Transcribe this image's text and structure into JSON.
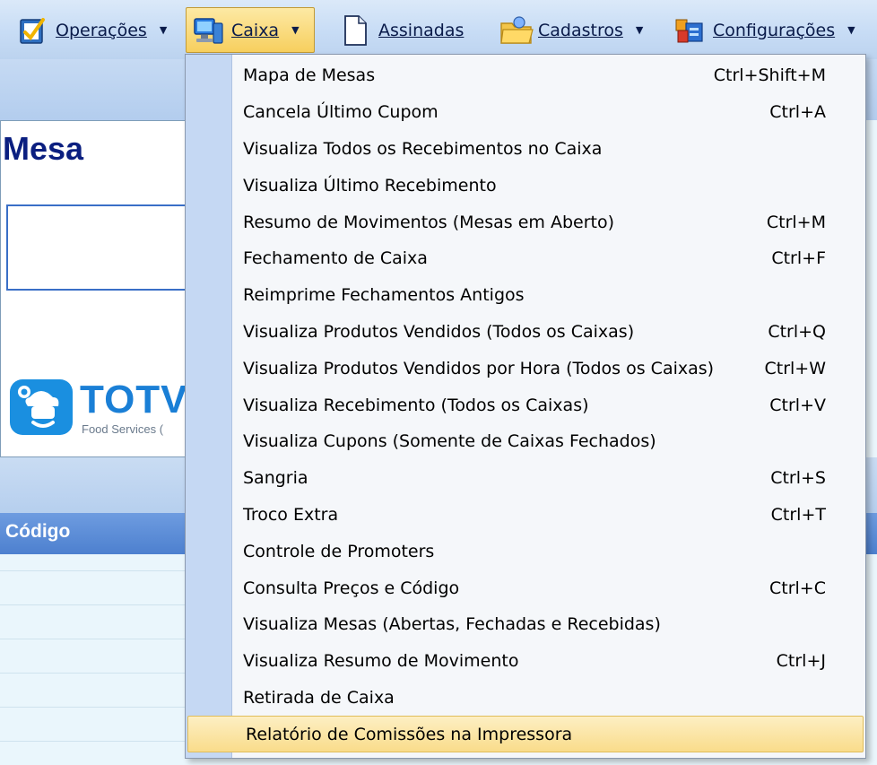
{
  "menubar": {
    "items": [
      {
        "label": "Operações",
        "icon": "clipboard-check-icon",
        "has_arrow": true
      },
      {
        "label": "Caixa",
        "icon": "computer-icon",
        "has_arrow": true,
        "open": true
      },
      {
        "label": "Assinadas",
        "icon": "document-icon",
        "has_arrow": false
      },
      {
        "label": "Cadastros",
        "icon": "folder-icon",
        "has_arrow": true
      },
      {
        "label": "Configurações",
        "icon": "settings-icon",
        "has_arrow": true
      }
    ],
    "arrow_glyph": "▼"
  },
  "background": {
    "panel_title": "Mesa",
    "logo_text": "TOTV",
    "logo_subtext": "Food Services (",
    "grid_header": "Código"
  },
  "dropdown": {
    "items": [
      {
        "label": "Mapa de Mesas",
        "shortcut": "Ctrl+Shift+M"
      },
      {
        "label": "Cancela Último Cupom",
        "shortcut": "Ctrl+A"
      },
      {
        "label": "Visualiza Todos os Recebimentos no Caixa",
        "shortcut": ""
      },
      {
        "label": "Visualiza Último Recebimento",
        "shortcut": ""
      },
      {
        "label": "Resumo de Movimentos (Mesas em Aberto)",
        "shortcut": "Ctrl+M"
      },
      {
        "label": "Fechamento de Caixa",
        "shortcut": "Ctrl+F"
      },
      {
        "label": "Reimprime Fechamentos Antigos",
        "shortcut": ""
      },
      {
        "label": "Visualiza Produtos Vendidos (Todos os Caixas)",
        "shortcut": "Ctrl+Q"
      },
      {
        "label": "Visualiza Produtos Vendidos por Hora (Todos os Caixas)",
        "shortcut": "Ctrl+W"
      },
      {
        "label": "Visualiza Recebimento (Todos os Caixas)",
        "shortcut": "Ctrl+V"
      },
      {
        "label": "Visualiza Cupons (Somente de Caixas Fechados)",
        "shortcut": ""
      },
      {
        "label": "Sangria",
        "shortcut": "Ctrl+S"
      },
      {
        "label": "Troco Extra",
        "shortcut": "Ctrl+T"
      },
      {
        "label": "Controle de Promoters",
        "shortcut": ""
      },
      {
        "label": "Consulta Preços e Código",
        "shortcut": "Ctrl+C"
      },
      {
        "label": "Visualiza Mesas (Abertas, Fechadas e Recebidas)",
        "shortcut": ""
      },
      {
        "label": "Visualiza Resumo de Movimento",
        "shortcut": "Ctrl+J"
      },
      {
        "label": "Retirada de Caixa",
        "shortcut": ""
      },
      {
        "label": "Relatório de Comissões na Impressora",
        "shortcut": "",
        "highlighted": true
      }
    ]
  },
  "colors": {
    "menubar_text": "#0a1b4a",
    "panel_title": "#0b1f80",
    "grid_header_bg": "#4d80cf",
    "highlight_bg": "#f9dc8b",
    "dropdown_gutter": "#c5d8f3",
    "logo_blue": "#1a8fe0"
  }
}
